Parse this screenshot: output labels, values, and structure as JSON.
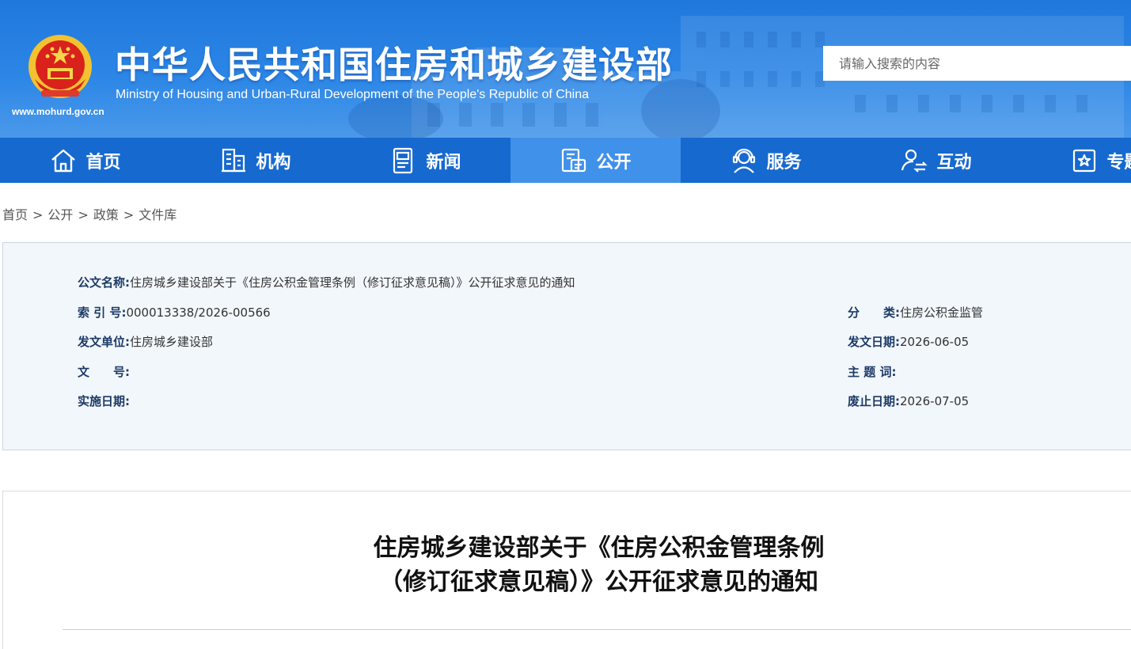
{
  "header": {
    "title_cn": "中华人民共和国住房和城乡建设部",
    "title_en": "Ministry of Housing and Urban-Rural Development of the People's Republic of China",
    "url": "www.mohurd.gov.cn",
    "search_placeholder": "请输入搜索的内容"
  },
  "nav": [
    {
      "label": "首页",
      "icon": "home-icon"
    },
    {
      "label": "机构",
      "icon": "building-icon"
    },
    {
      "label": "新闻",
      "icon": "news-icon"
    },
    {
      "label": "公开",
      "icon": "disclosure-icon",
      "active": true
    },
    {
      "label": "服务",
      "icon": "service-icon"
    },
    {
      "label": "互动",
      "icon": "interaction-icon"
    },
    {
      "label": "专题",
      "icon": "topic-star-icon"
    }
  ],
  "breadcrumb": [
    "首页",
    "公开",
    "政策",
    "文件库"
  ],
  "meta": {
    "doc_name_label": "公文名称:",
    "doc_name": "住房城乡建设部关于《住房公积金管理条例（修订征求意见稿）》公开征求意见的通知",
    "index_label": "索 引 号:",
    "index": "000013338/2026-00566",
    "category_label": "分　　类:",
    "category": "住房公积金监管",
    "issuer_label": "发文单位:",
    "issuer": "住房城乡建设部",
    "issue_date_label": "发文日期:",
    "issue_date": "2026-06-05",
    "doc_no_label": "文　　号:",
    "doc_no": "",
    "keywords_label": "主 题 词:",
    "keywords": "",
    "effective_label": "实施日期:",
    "effective": "",
    "abolish_label": "废止日期:",
    "abolish": "2026-07-05"
  },
  "article": {
    "title_line1": "住房城乡建设部关于《住房公积金管理条例",
    "title_line2": "（修订征求意见稿）》公开征求意见的通知"
  },
  "colors": {
    "banner": "#2c86e6",
    "nav": "#1669cf",
    "nav_active": "#3f91ea",
    "meta_bg": "#f2f7fc",
    "meta_label": "#1c3a66"
  }
}
